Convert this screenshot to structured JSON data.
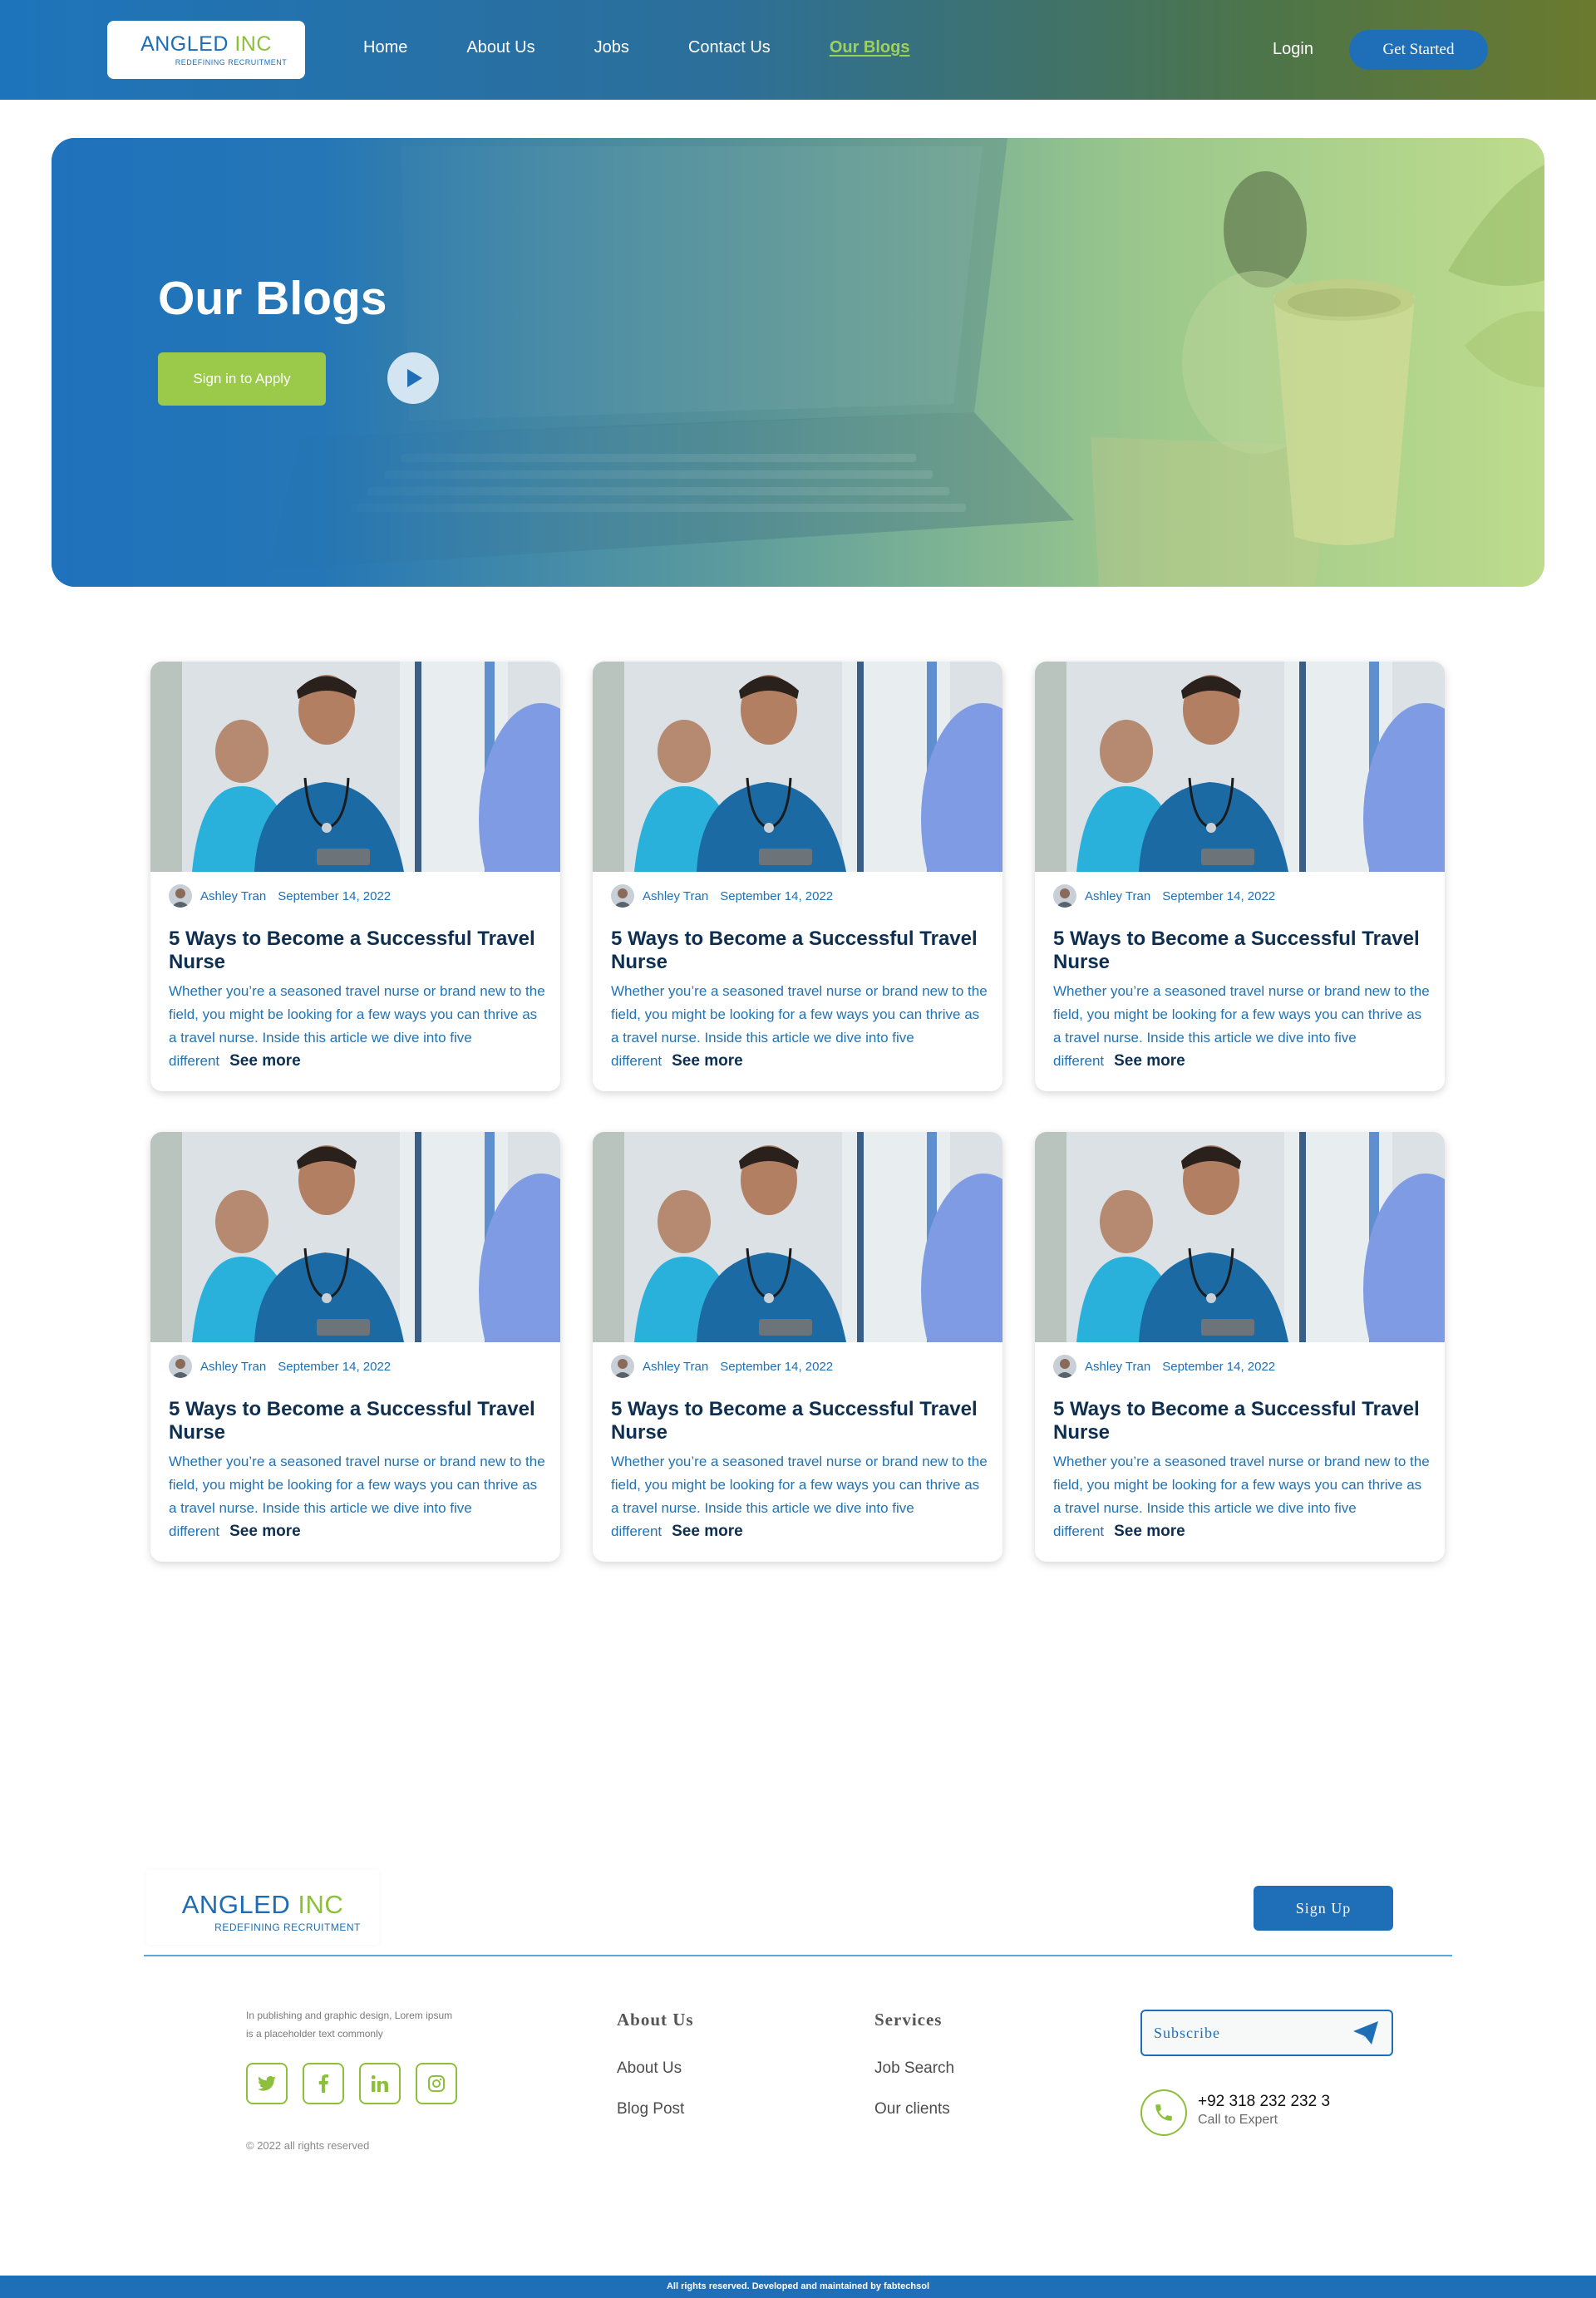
{
  "nav": {
    "logo_main": "ANGLED",
    "logo_accent": "INC",
    "logo_sub": "REDEFINING RECRUITMENT",
    "links": [
      {
        "label": "Home"
      },
      {
        "label": "About Us"
      },
      {
        "label": "Jobs"
      },
      {
        "label": "Contact Us"
      },
      {
        "label": "Our Blogs",
        "active": true
      }
    ],
    "login": "Login",
    "cta": "Get Started"
  },
  "hero": {
    "title": "Our Blogs",
    "button": "Sign in to Apply",
    "play_icon": "play-icon"
  },
  "blog": {
    "posts": [
      {
        "author": "Ashley Tran",
        "date": "September 14, 2022",
        "title": "5 Ways to Become a Successful Travel Nurse",
        "excerpt": "Whether you’re a seasoned travel nurse or brand new to the field, you might be looking for a few ways you can thrive as a travel nurse. Inside this article we dive into five different",
        "more": "See more"
      },
      {
        "author": "Ashley Tran",
        "date": "September 14, 2022",
        "title": "5 Ways to Become a Successful Travel Nurse",
        "excerpt": "Whether you’re a seasoned travel nurse or brand new to the field, you might be looking for a few ways you can thrive as a travel nurse. Inside this article we dive into five different",
        "more": "See more"
      },
      {
        "author": "Ashley Tran",
        "date": "September 14, 2022",
        "title": "5 Ways to Become a Successful Travel Nurse",
        "excerpt": "Whether you’re a seasoned travel nurse or brand new to the field, you might be looking for a few ways you can thrive as a travel nurse. Inside this article we dive into five different",
        "more": "See more"
      },
      {
        "author": "Ashley Tran",
        "date": "September 14, 2022",
        "title": "5 Ways to Become a Successful Travel Nurse",
        "excerpt": "Whether you’re a seasoned travel nurse or brand new to the field, you might be looking for a few ways you can thrive as a travel nurse. Inside this article we dive into five different",
        "more": "See more"
      },
      {
        "author": "Ashley Tran",
        "date": "September 14, 2022",
        "title": "5 Ways to Become a Successful Travel Nurse",
        "excerpt": "Whether you’re a seasoned travel nurse or brand new to the field, you might be looking for a few ways you can thrive as a travel nurse. Inside this article we dive into five different",
        "more": "See more"
      },
      {
        "author": "Ashley Tran",
        "date": "September 14, 2022",
        "title": "5 Ways to Become a Successful Travel Nurse",
        "excerpt": "Whether you’re a seasoned travel nurse or brand new to the field, you might be looking for a few ways you can thrive as a travel nurse. Inside this article we dive into five different",
        "more": "See more"
      }
    ]
  },
  "footer": {
    "logo_main": "ANGLED",
    "logo_accent": "INC",
    "logo_sub": "REDEFINING RECRUITMENT",
    "signup": "Sign Up",
    "description": "In publishing and graphic design, Lorem ipsum is a placeholder text commonly",
    "socials": [
      "twitter-icon",
      "facebook-icon",
      "linkedin-icon",
      "instagram-icon"
    ],
    "copyright": "© 2022 all rights reserved",
    "about_heading": "About Us",
    "about_links": [
      "About Us",
      "Blog Post"
    ],
    "services_heading": "Services",
    "services_links": [
      "Job Search",
      "Our clients"
    ],
    "subscribe_placeholder": "Subscribe",
    "phone": "+92 318 232 232 3",
    "phone_sub": "Call to Expert",
    "bottom_bar": "All rights reserved. Developed and maintained by fabtechsol"
  },
  "colors": {
    "brand_blue": "#1f6fb8",
    "brand_green": "#8cc03a",
    "title_navy": "#0f2f50"
  }
}
